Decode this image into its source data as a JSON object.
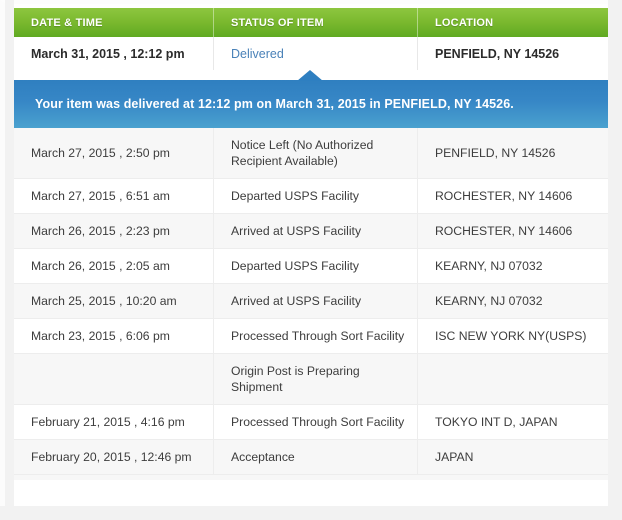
{
  "table": {
    "columns": [
      {
        "key": "date",
        "label": "DATE & TIME"
      },
      {
        "key": "status",
        "label": "STATUS OF ITEM"
      },
      {
        "key": "location",
        "label": "LOCATION"
      }
    ],
    "latest_event": {
      "date": "March 31, 2015 , 12:12 pm",
      "status": "Delivered",
      "location": "PENFIELD, NY 14526"
    },
    "banner": {
      "message": "Your item was delivered at 12:12 pm on March 31, 2015 in PENFIELD, NY 14526."
    },
    "history": [
      {
        "date": "March 27, 2015 , 2:50 pm",
        "status": "Notice Left (No Authorized Recipient Available)",
        "location": "PENFIELD, NY 14526"
      },
      {
        "date": "March 27, 2015 , 6:51 am",
        "status": "Departed USPS Facility",
        "location": "ROCHESTER, NY 14606"
      },
      {
        "date": "March 26, 2015 , 2:23 pm",
        "status": "Arrived at USPS Facility",
        "location": "ROCHESTER, NY 14606"
      },
      {
        "date": "March 26, 2015 , 2:05 am",
        "status": "Departed USPS Facility",
        "location": "KEARNY, NJ 07032"
      },
      {
        "date": "March 25, 2015 , 10:20 am",
        "status": "Arrived at USPS Facility",
        "location": "KEARNY, NJ 07032"
      },
      {
        "date": "March 23, 2015 , 6:06 pm",
        "status": "Processed Through Sort Facility",
        "location": "ISC NEW YORK NY(USPS)"
      },
      {
        "date": "",
        "status": "Origin Post is Preparing Shipment",
        "location": ""
      },
      {
        "date": "February 21, 2015 , 4:16 pm",
        "status": "Processed Through Sort Facility",
        "location": "TOKYO INT D, JAPAN"
      },
      {
        "date": "February 20, 2015 , 12:46 pm",
        "status": "Acceptance",
        "location": "JAPAN"
      }
    ]
  },
  "colors": {
    "header_green_top": "#8dc63f",
    "header_green_bottom": "#5faa22",
    "banner_blue_top": "#2f7fc0",
    "banner_blue_bottom": "#4aa1cf",
    "status_link_blue": "#4a82b8",
    "row_alt_gray": "#f7f7f7"
  }
}
